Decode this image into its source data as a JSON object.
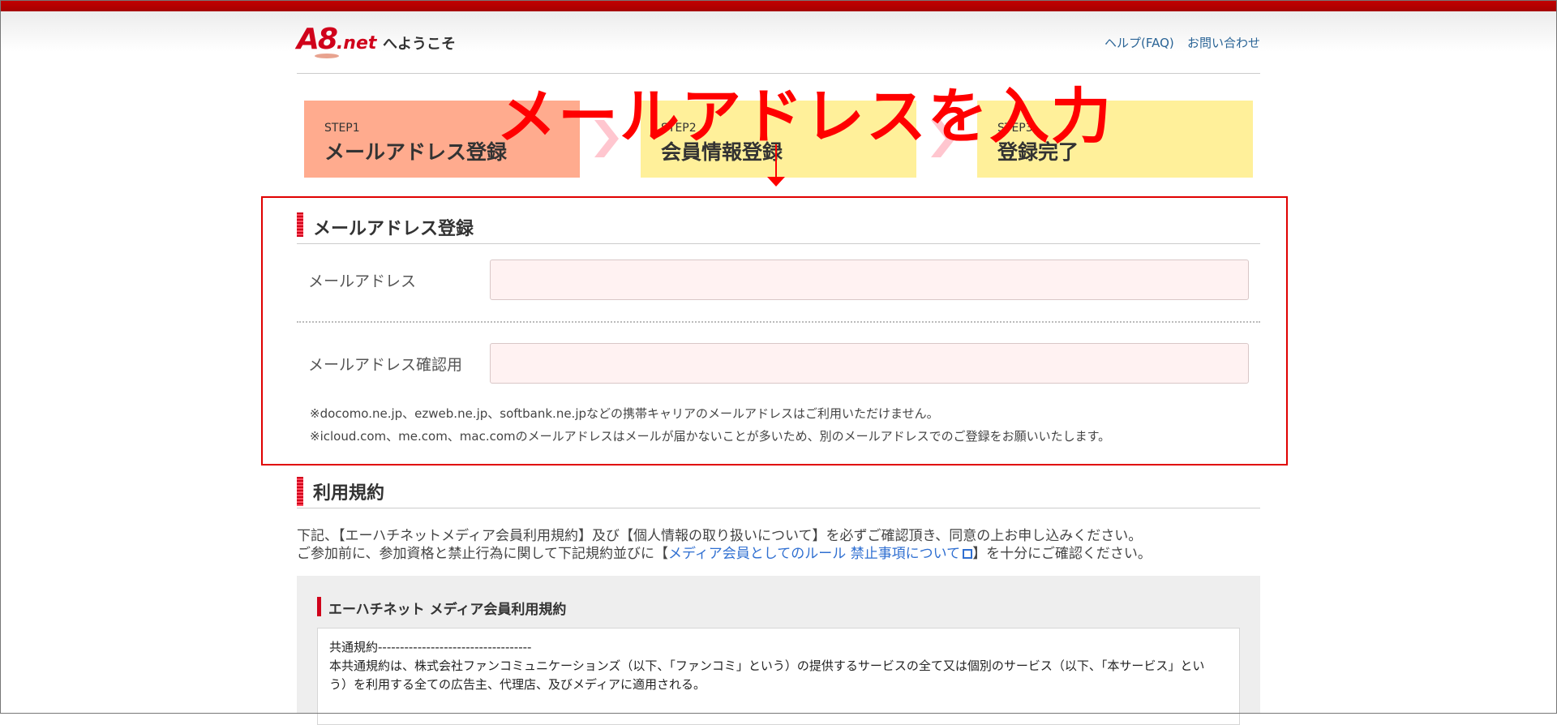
{
  "header": {
    "logo_main": "A8",
    "logo_suffix": ".net",
    "welcome": "へようこそ",
    "help_link": "ヘルプ(FAQ)",
    "contact_link": "お問い合わせ"
  },
  "annotation": {
    "title": "メールアドレスを入力",
    "color": "#ff0000"
  },
  "steps": [
    {
      "num": "STEP1",
      "title": "メールアドレス登録",
      "active": true
    },
    {
      "num": "STEP2",
      "title": "会員情報登録",
      "active": false
    },
    {
      "num": "STEP3",
      "title": "登録完了",
      "active": false
    }
  ],
  "email_section": {
    "heading": "メールアドレス登録",
    "email_label": "メールアドレス",
    "email_value": "",
    "confirm_label": "メールアドレス確認用",
    "confirm_value": "",
    "note1": "※docomo.ne.jp、ezweb.ne.jp、softbank.ne.jpなどの携帯キャリアのメールアドレスはご利用いただけません。",
    "note2": "※icloud.com、me.com、mac.comのメールアドレスはメールが届かないことが多いため、別のメールアドレスでのご登録をお願いいたします。"
  },
  "terms_section": {
    "heading": "利用規約",
    "intro1": "下記、【エーハチネットメディア会員利用規約】及び【個人情報の取り扱いについて】を必ずご確認頂き、同意の上お申し込みください。",
    "intro2_prefix": "ご参加前に、参加資格と禁止行為に関して下記規約並びに【",
    "intro2_link": "メディア会員としてのルール 禁止事項について",
    "intro2_suffix": "】を十分にご確認ください。",
    "box_heading": "エーハチネット メディア会員利用規約",
    "box_line1": "共通規約-----------------------------------",
    "box_line2": "本共通規約は、株式会社ファンコミュニケーションズ（以下、「ファンコミ」という）の提供するサービスの全て又は個別のサービス（以下、「本サービス」とい",
    "box_line3": "う）を利用する全ての広告主、代理店、及びメディアに適用される。"
  },
  "colors": {
    "brand_red": "#d0021b",
    "step_active": "#ffab8e",
    "step_inactive": "#fff09a",
    "input_bg": "#fff2f2",
    "link_blue": "#2f6fd1"
  }
}
